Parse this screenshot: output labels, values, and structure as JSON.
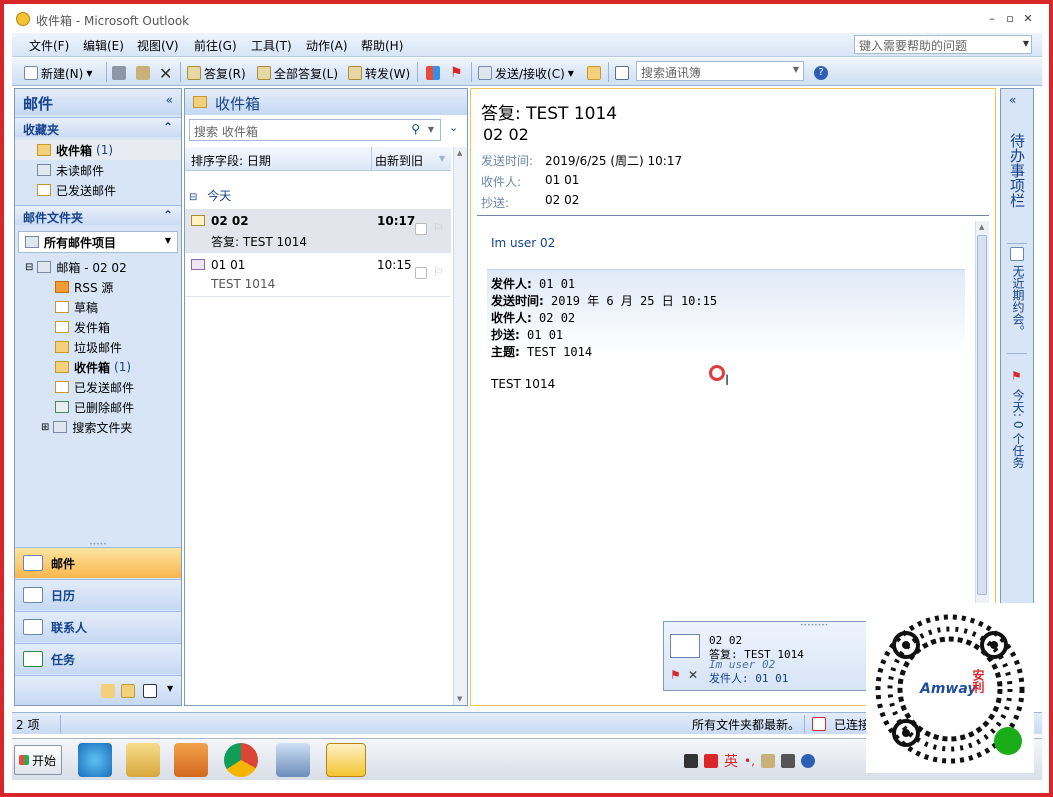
{
  "window": {
    "title": "收件箱 - Microsoft Outlook"
  },
  "menu": {
    "items": [
      "文件(F)",
      "编辑(E)",
      "视图(V)",
      "前往(G)",
      "工具(T)",
      "动作(A)",
      "帮助(H)"
    ],
    "help_placeholder": "键入需要帮助的问题"
  },
  "toolbar": {
    "new": "新建(N)",
    "reply": "答复(R)",
    "reply_all": "全部答复(L)",
    "forward": "转发(W)",
    "send_receive": "发送/接收(C)",
    "contact_search": "搜索通讯簿"
  },
  "nav": {
    "title": "邮件",
    "favorites_title": "收藏夹",
    "favorites": [
      {
        "label": "收件箱",
        "count": "(1)"
      },
      {
        "label": "未读邮件",
        "count": ""
      },
      {
        "label": "已发送邮件",
        "count": ""
      }
    ],
    "folders_title": "邮件文件夹",
    "all_items": "所有邮件项目",
    "mailbox": "邮箱 - 02 02",
    "folders": [
      {
        "label": "RSS 源",
        "count": ""
      },
      {
        "label": "草稿",
        "count": ""
      },
      {
        "label": "发件箱",
        "count": ""
      },
      {
        "label": "垃圾邮件",
        "count": ""
      },
      {
        "label": "收件箱",
        "count": "(1)"
      },
      {
        "label": "已发送邮件",
        "count": ""
      },
      {
        "label": "已删除邮件",
        "count": ""
      },
      {
        "label": "搜索文件夹",
        "count": ""
      }
    ],
    "buttons": [
      "邮件",
      "日历",
      "联系人",
      "任务"
    ]
  },
  "list": {
    "title": "收件箱",
    "search_placeholder": "搜索 收件箱",
    "sort_label": "排序字段: 日期",
    "sort_order": "由新到旧",
    "group": "今天",
    "messages": [
      {
        "from": "02 02",
        "time": "10:17",
        "subject": "答复: TEST 1014",
        "unread": true
      },
      {
        "from": "01 01",
        "time": "10:15",
        "subject": "TEST 1014",
        "unread": false
      }
    ]
  },
  "reading": {
    "subject": "答复: TEST 1014",
    "from": "02 02",
    "sent_label": "发送时间:",
    "sent_value": "2019/6/25 (周二) 10:17",
    "to_label": "收件人:",
    "to_value": "01 01",
    "cc_label": "抄送:",
    "cc_value": "02 02",
    "body_line": "Im user 02",
    "quote": [
      {
        "k": "发件人:",
        "v": " 01 01"
      },
      {
        "k": "发送时间:",
        "v": " 2019 年 6 月 25 日 10:15"
      },
      {
        "k": "收件人:",
        "v": " 02 02"
      },
      {
        "k": "抄送:",
        "v": " 01 01"
      },
      {
        "k": "主题:",
        "v": " TEST 1014"
      }
    ],
    "quote_body": "TEST 1014"
  },
  "todo": {
    "title": "待办事项栏",
    "appointments": "无近期约会。",
    "tasks": "今天: 0 个任务"
  },
  "popup": {
    "from": "02 02",
    "subject": "答复: TEST 1014",
    "preview": "Im user 02",
    "sender": "发件人: 01 01"
  },
  "status": {
    "items": "2 项",
    "updated": "所有文件夹都最新。",
    "connected": "已连接"
  },
  "taskbar": {
    "start": "开始",
    "ime": "英"
  },
  "qr": {
    "brand": "Amway",
    "brand_cn": "安利"
  }
}
